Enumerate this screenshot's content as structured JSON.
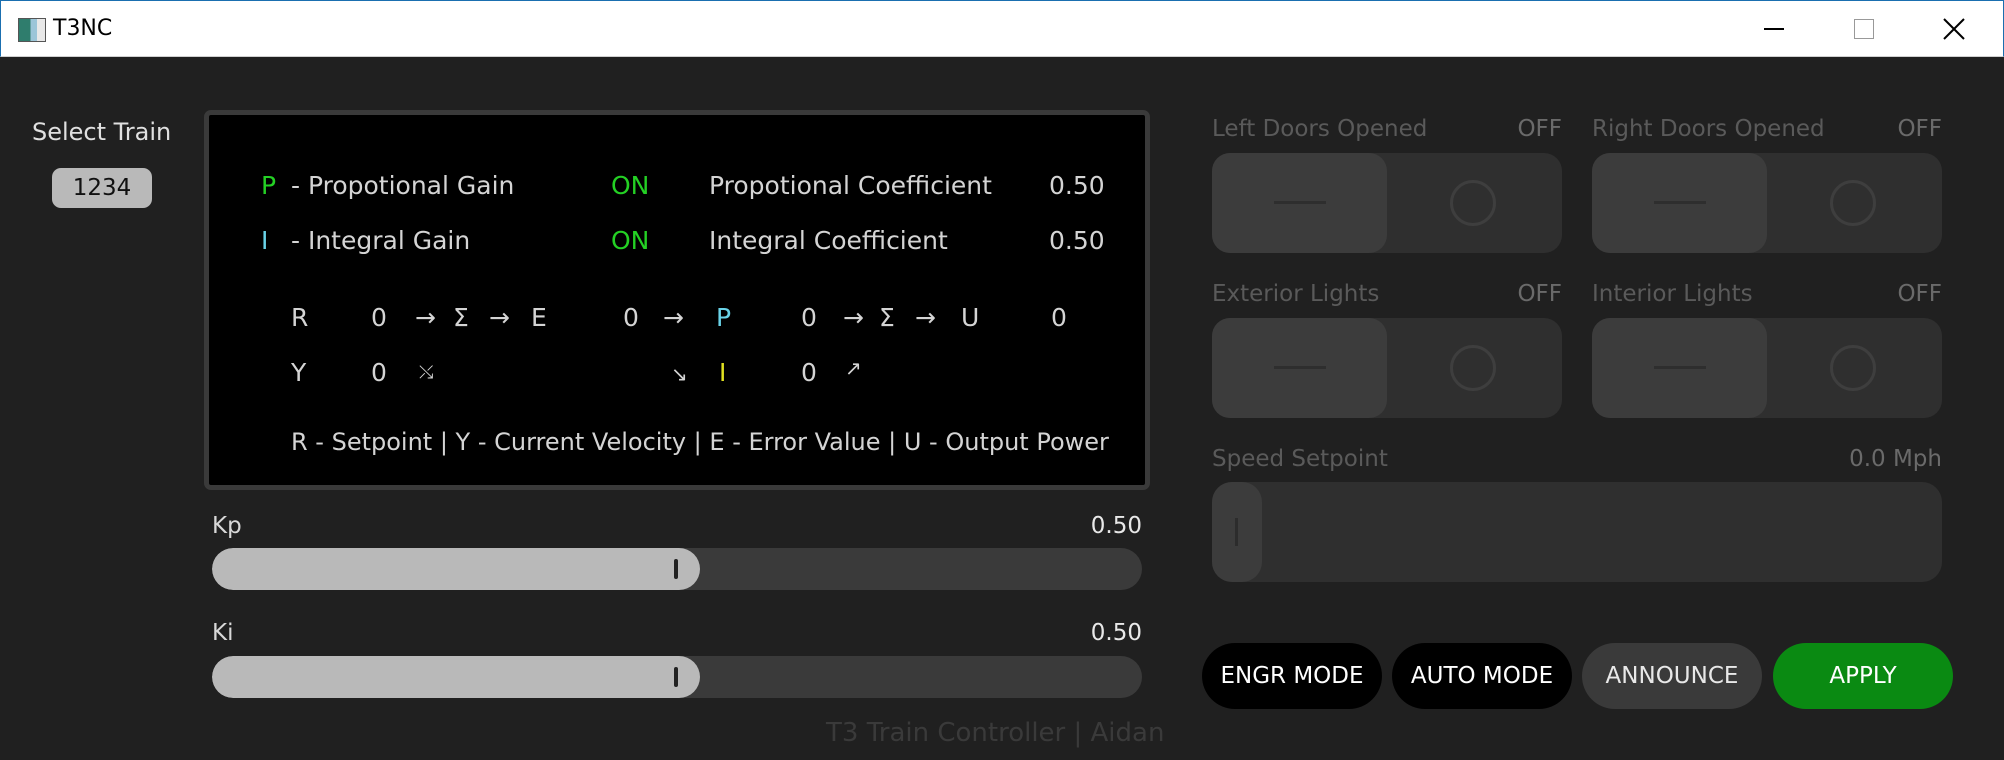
{
  "window": {
    "title": "T3NC"
  },
  "left": {
    "select_label": "Select Train",
    "train_id": "1234"
  },
  "diagram": {
    "p_letter": "P",
    "p_desc": "- Propotional Gain",
    "p_state": "ON",
    "p_coef_label": "Propotional Coefficient",
    "p_coef_value": "0.50",
    "i_letter": "I",
    "i_desc": "- Integral Gain",
    "i_state": "ON",
    "i_coef_label": "Integral Coefficient",
    "i_coef_value": "0.50",
    "row1": {
      "r": "R",
      "r_val": "0",
      "sum1": "Σ",
      "e": "E",
      "e_val": "0",
      "p": "P",
      "p_val": "0",
      "sum2": "Σ",
      "u": "U",
      "u_val": "0"
    },
    "row2": {
      "y": "Y",
      "y_val": "0",
      "i": "I",
      "i_val": "0"
    },
    "legend": "R - Setpoint | Y - Current Velocity | E - Error Value | U - Output Power"
  },
  "sliders": {
    "kp": {
      "label": "Kp",
      "value_text": "0.50",
      "fraction": 0.525
    },
    "ki": {
      "label": "Ki",
      "value_text": "0.50",
      "fraction": 0.525
    }
  },
  "footer": "T3 Train Controller | Aidan",
  "toggles": {
    "left_doors": {
      "label": "Left Doors Opened",
      "state": "OFF"
    },
    "right_doors": {
      "label": "Right Doors Opened",
      "state": "OFF"
    },
    "exterior_lights": {
      "label": "Exterior Lights",
      "state": "OFF"
    },
    "interior_lights": {
      "label": "Interior Lights",
      "state": "OFF"
    }
  },
  "speed": {
    "label": "Speed Setpoint",
    "value": "0.0 Mph"
  },
  "buttons": {
    "engr": "ENGR MODE",
    "auto": "AUTO MODE",
    "announce": "ANNOUNCE",
    "apply": "APPLY"
  },
  "colors": {
    "on_green": "#24d024",
    "apply_green": "#0a8a12",
    "p_cyan": "#6ad3e8",
    "i_yellow": "#e0e020"
  }
}
